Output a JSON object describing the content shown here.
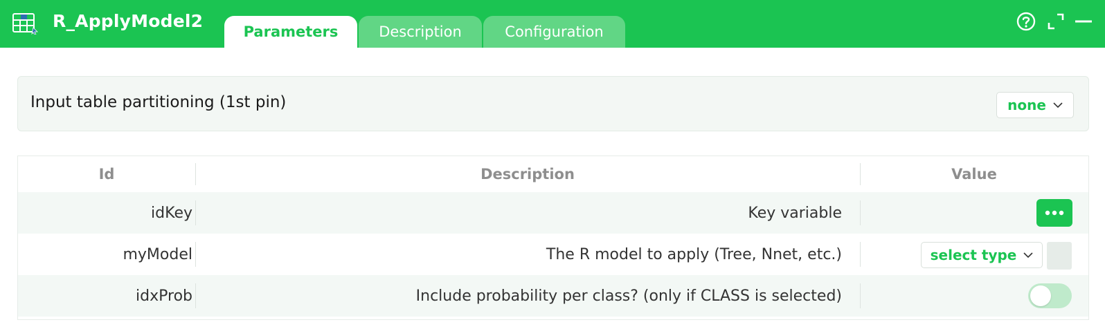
{
  "app": {
    "title": "R_ApplyModel2",
    "icon": "grid-table-icon"
  },
  "tabs": [
    {
      "label": "Parameters",
      "active": true
    },
    {
      "label": "Description",
      "active": false
    },
    {
      "label": "Configuration",
      "active": false
    }
  ],
  "header_actions": [
    {
      "name": "help",
      "icon": "help-circle-icon"
    },
    {
      "name": "expand",
      "icon": "expand-icon"
    },
    {
      "name": "minimize",
      "icon": "minimize-icon"
    }
  ],
  "partitioning": {
    "label": "Input table partitioning (1st pin)",
    "value": "none"
  },
  "table": {
    "columns": [
      "Id",
      "Description",
      "Value"
    ],
    "rows": [
      {
        "id": "idKey",
        "description": "Key variable",
        "control": "button",
        "control_icon": "more-dots-icon"
      },
      {
        "id": "myModel",
        "description": "The R model to apply (Tree, Nnet, etc.)",
        "control": "select",
        "value": "select type"
      },
      {
        "id": "idxProb",
        "description": "Include probability per class? (only if CLASS is selected)",
        "control": "toggle",
        "checked": false
      }
    ]
  },
  "colors": {
    "accent": "#1bc452",
    "tab_inactive": "#61d685",
    "row_alt": "#f3f8f5"
  }
}
